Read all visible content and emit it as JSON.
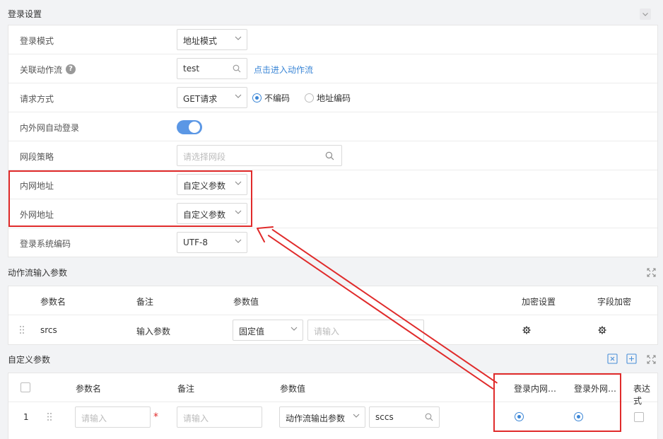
{
  "login_settings": {
    "title": "登录设置",
    "rows": {
      "login_mode": {
        "label": "登录模式",
        "value": "地址模式"
      },
      "action_flow": {
        "label": "关联动作流",
        "value": "test",
        "link": "点击进入动作流"
      },
      "request_method": {
        "label": "请求方式",
        "value": "GET请求",
        "options": [
          "不编码",
          "地址编码"
        ]
      },
      "auto_login": {
        "label": "内外网自动登录"
      },
      "segment_policy": {
        "label": "网段策略",
        "placeholder": "请选择网段"
      },
      "intranet_addr": {
        "label": "内网地址",
        "value": "自定义参数"
      },
      "extranet_addr": {
        "label": "外网地址",
        "value": "自定义参数"
      },
      "encoding": {
        "label": "登录系统编码",
        "value": "UTF-8"
      }
    }
  },
  "flow_params": {
    "title": "动作流输入参数",
    "headers": [
      "参数名",
      "备注",
      "参数值",
      "加密设置",
      "字段加密"
    ],
    "rows": [
      {
        "name": "srcs",
        "note": "输入参数",
        "value_type": "固定值",
        "value_placeholder": "请输入"
      }
    ]
  },
  "custom_params": {
    "title": "自定义参数",
    "headers": [
      "参数名",
      "备注",
      "参数值",
      "登录内网…",
      "登录外网…",
      "表达式"
    ],
    "rows": [
      {
        "index": "1",
        "name_placeholder": "请输入",
        "note_placeholder": "请输入",
        "value_type": "动作流输出参数",
        "value": "sccs",
        "required_mark": "*"
      }
    ]
  },
  "colors": {
    "accent": "#3b86d6",
    "annotation": "#e02b2b",
    "toggle_on": "#5b97e5"
  }
}
